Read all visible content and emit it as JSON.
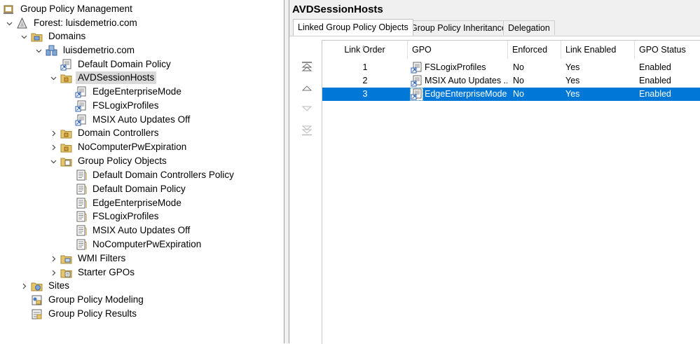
{
  "tree": {
    "items": [
      {
        "label": "Group Policy Management",
        "icon": "gpm-console-icon"
      },
      {
        "label": "Forest: luisdemetrio.com",
        "icon": "forest-icon"
      },
      {
        "label": "Domains",
        "icon": "domains-folder-icon"
      },
      {
        "label": "luisdemetrio.com",
        "icon": "domain-icon"
      },
      {
        "label": "Default Domain Policy",
        "icon": "gpo-link-icon"
      },
      {
        "label": "AVDSessionHosts",
        "icon": "ou-icon"
      },
      {
        "label": "EdgeEnterpriseMode",
        "icon": "gpo-link-icon"
      },
      {
        "label": "FSLogixProfiles",
        "icon": "gpo-link-icon"
      },
      {
        "label": "MSIX Auto Updates Off",
        "icon": "gpo-link-icon"
      },
      {
        "label": "Domain Controllers",
        "icon": "ou-icon"
      },
      {
        "label": "NoComputerPwExpiration",
        "icon": "ou-icon"
      },
      {
        "label": "Group Policy Objects",
        "icon": "gpo-folder-icon"
      },
      {
        "label": "Default Domain Controllers Policy",
        "icon": "gpo-icon"
      },
      {
        "label": "Default Domain Policy",
        "icon": "gpo-icon"
      },
      {
        "label": "EdgeEnterpriseMode",
        "icon": "gpo-icon"
      },
      {
        "label": "FSLogixProfiles",
        "icon": "gpo-icon"
      },
      {
        "label": "MSIX Auto Updates Off",
        "icon": "gpo-icon"
      },
      {
        "label": "NoComputerPwExpiration",
        "icon": "gpo-icon"
      },
      {
        "label": "WMI Filters",
        "icon": "wmi-folder-icon"
      },
      {
        "label": "Starter GPOs",
        "icon": "starter-folder-icon"
      },
      {
        "label": "Sites",
        "icon": "sites-icon"
      },
      {
        "label": "Group Policy Modeling",
        "icon": "modeling-icon"
      },
      {
        "label": "Group Policy Results",
        "icon": "results-icon"
      }
    ]
  },
  "right": {
    "title": "AVDSessionHosts",
    "tabs": [
      {
        "label": "Linked Group Policy Objects",
        "active": true
      },
      {
        "label": "Group Policy Inheritance",
        "active": false
      },
      {
        "label": "Delegation",
        "active": false
      }
    ],
    "order_buttons": [
      {
        "icon": "move-top-icon"
      },
      {
        "icon": "move-up-icon"
      },
      {
        "icon": "move-down-icon"
      },
      {
        "icon": "move-bottom-icon"
      }
    ],
    "grid": {
      "columns": [
        "Link Order",
        "GPO",
        "Enforced",
        "Link Enabled",
        "GPO Status"
      ],
      "rows": [
        {
          "order": "1",
          "gpo": "FSLogixProfiles",
          "enforced": "No",
          "link_enabled": "Yes",
          "status": "Enabled",
          "selected": false
        },
        {
          "order": "2",
          "gpo": "MSIX Auto Updates ...",
          "enforced": "No",
          "link_enabled": "Yes",
          "status": "Enabled",
          "selected": false
        },
        {
          "order": "3",
          "gpo": "EdgeEnterpriseMode",
          "enforced": "No",
          "link_enabled": "Yes",
          "status": "Enabled",
          "selected": true
        }
      ]
    }
  },
  "colors": {
    "selection": "#0078d7",
    "tree_selection": "#d9d9d9",
    "header_bg": "#f0f0f0"
  }
}
